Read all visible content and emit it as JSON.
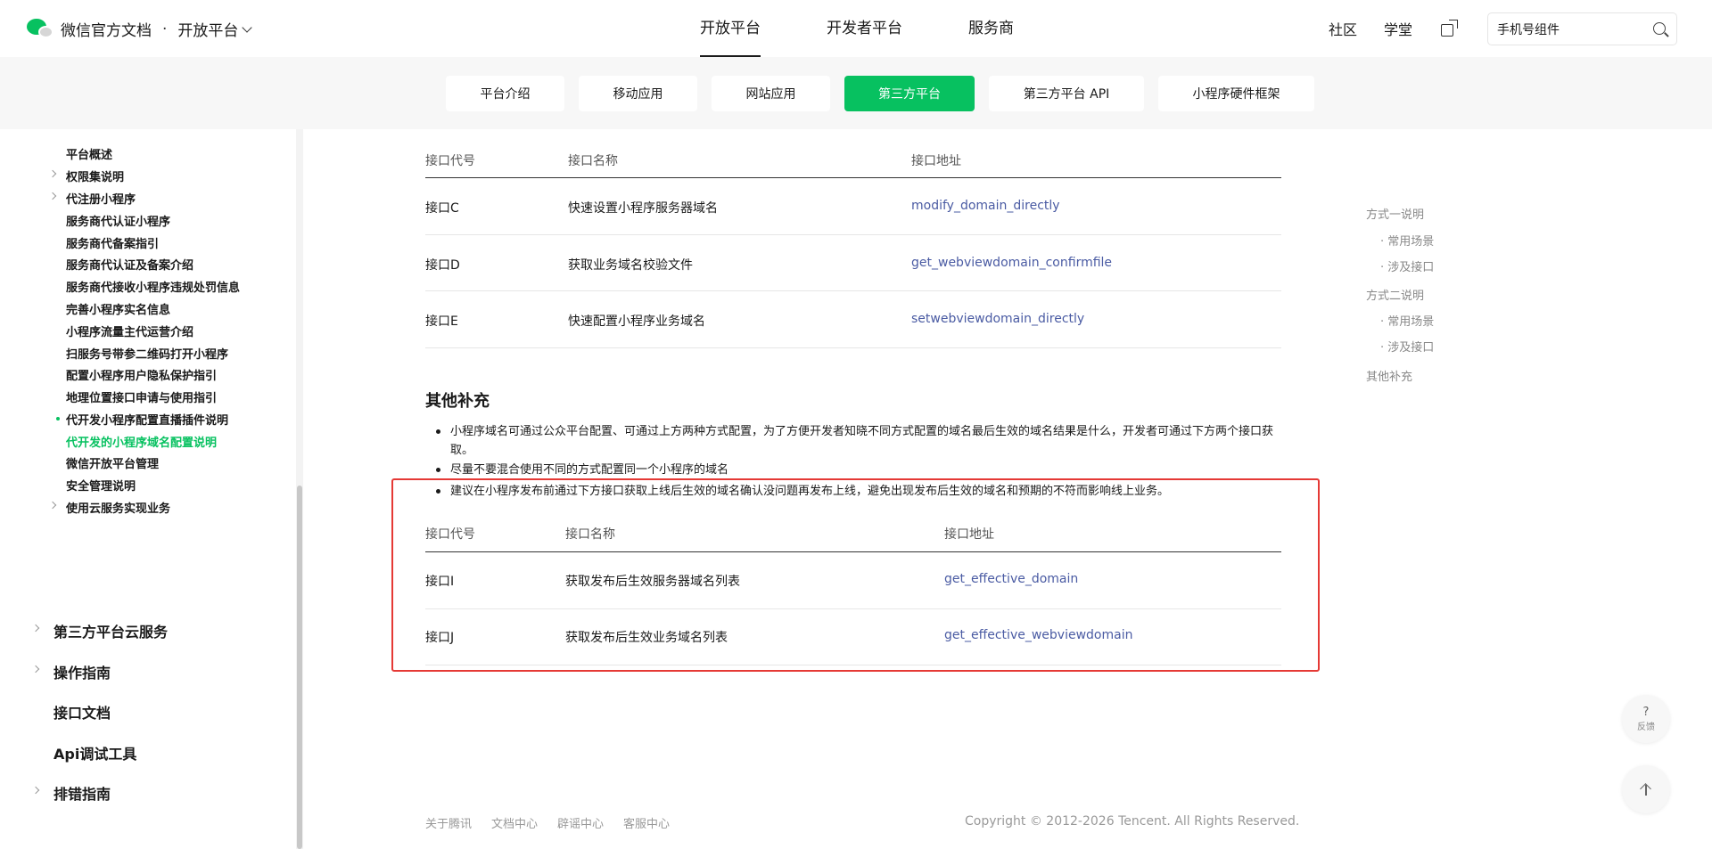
{
  "header": {
    "brand": "微信官方文档",
    "separator": "·",
    "platform_selector": "开放平台",
    "nav": [
      "开放平台",
      "开发者平台",
      "服务商"
    ],
    "right_links": [
      "社区",
      "学堂"
    ],
    "search_value": "手机号组件"
  },
  "subtabs": [
    "平台介绍",
    "移动应用",
    "网站应用",
    "第三方平台",
    "第三方平台 API",
    "小程序硬件框架"
  ],
  "subtabs_active": "第三方平台",
  "sidebar": {
    "items": [
      "平台概述",
      "权限集说明",
      "代注册小程序",
      "服务商代认证小程序",
      "服务商代备案指引",
      "服务商代认证及备案介绍",
      "服务商代接收小程序违规处罚信息",
      "完善小程序实名信息",
      "小程序流量主代运营介绍",
      "扫服务号带参二维码打开小程序",
      "配置小程序用户隐私保护指引",
      "地理位置接口申请与使用指引",
      "代开发小程序配置直播插件说明",
      "代开发的小程序域名配置说明",
      "微信开放平台管理",
      "安全管理说明",
      "使用云服务实现业务"
    ],
    "sections": [
      "第三方平台云服务",
      "操作指南",
      "接口文档",
      "Api调试工具",
      "排错指南"
    ]
  },
  "table1": {
    "headers": [
      "接口代号",
      "接口名称",
      "接口地址"
    ],
    "rows": [
      [
        "接口C",
        "快速设置小程序服务器域名",
        "modify_domain_directly"
      ],
      [
        "接口D",
        "获取业务域名校验文件",
        "get_webviewdomain_confirmfile"
      ],
      [
        "接口E",
        "快速配置小程序业务域名",
        "setwebviewdomain_directly"
      ]
    ]
  },
  "section_title": "其他补充",
  "bullets": [
    "小程序域名可通过公众平台配置、可通过上方两种方式配置，为了方便开发者知晓不同方式配置的域名最后生效的域名结果是什么，开发者可通过下方两个接口获取。",
    "尽量不要混合使用不同的方式配置同一个小程序的域名",
    "建议在小程序发布前通过下方接口获取上线后生效的域名确认没问题再发布上线，避免出现发布后生效的域名和预期的不符而影响线上业务。"
  ],
  "table2": {
    "headers": [
      "接口代号",
      "接口名称",
      "接口地址"
    ],
    "rows": [
      [
        "接口I",
        "获取发布后生效服务器域名列表",
        "get_effective_domain"
      ],
      [
        "接口J",
        "获取发布后生效业务域名列表",
        "get_effective_webviewdomain"
      ]
    ]
  },
  "toc": [
    "方式一说明",
    "· 常用场景",
    "· 涉及接口",
    "方式二说明",
    "· 常用场景",
    "· 涉及接口",
    "其他补充"
  ],
  "footer": {
    "links": [
      "关于腾讯",
      "文档中心",
      "辟谣中心",
      "客服中心"
    ],
    "copyright": "Copyright © 2012-2026 Tencent. All Rights Reserved."
  },
  "fab": {
    "feedback_q": "?",
    "feedback_label": "反馈"
  },
  "colors": {
    "accent": "#07c160",
    "link": "#4a5ba3",
    "highlight_box": "#e53935"
  }
}
